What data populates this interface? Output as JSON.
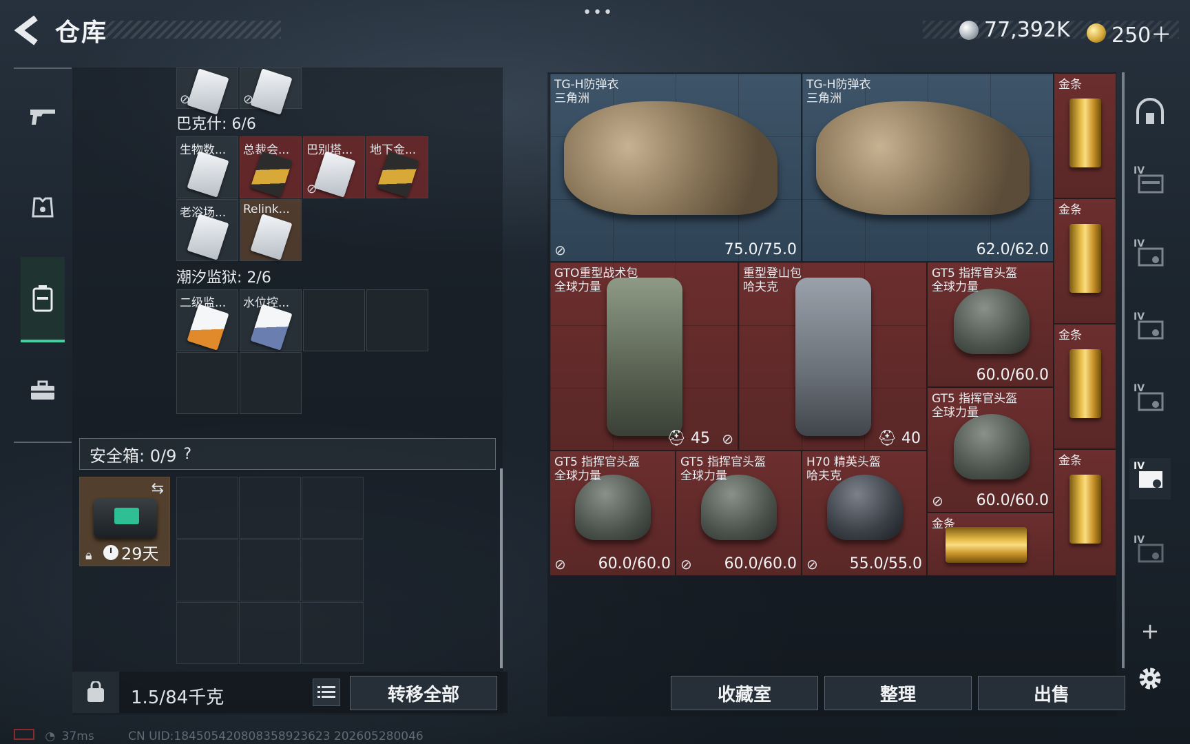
{
  "header": {
    "title": "仓库",
    "menu": "•••",
    "currency_silver": "77,392K",
    "currency_gold": "250＋"
  },
  "left_panel": {
    "partial_top_count": 2,
    "section1": {
      "label": "巴克什: 6/6",
      "items": [
        "生物数...",
        "总裁会...",
        "巴别塔...",
        "地下金...",
        "老浴场...",
        "Relink..."
      ]
    },
    "section2": {
      "label": "潮汐监狱: 2/6",
      "items": [
        "二级监...",
        "水位控..."
      ]
    },
    "safebox": {
      "label": "安全箱: 0/9",
      "help": "?",
      "item_timer": "29天"
    },
    "weight": "1.5/84千克",
    "transfer_all": "转移全部"
  },
  "stash": {
    "slots": [
      {
        "id": "vest1",
        "name": "TG-H防弹衣\n三角洲",
        "value": "75.0/75.0"
      },
      {
        "id": "vest2",
        "name": "TG-H防弹衣\n三角洲",
        "value": "62.0/62.0"
      },
      {
        "id": "gold1",
        "name": "金条"
      },
      {
        "id": "gold2",
        "name": "金条"
      },
      {
        "id": "bag1",
        "name": "GTO重型战术包\n全球力量",
        "cap": "45"
      },
      {
        "id": "bag2",
        "name": "重型登山包\n哈夫克",
        "cap": "40"
      },
      {
        "id": "helm1",
        "name": "GT5 指挥官头盔\n全球力量",
        "value": "60.0/60.0"
      },
      {
        "id": "gold3",
        "name": "金条"
      },
      {
        "id": "helm2",
        "name": "GT5 指挥官头盔\n全球力量",
        "value": "60.0/60.0"
      },
      {
        "id": "gold4",
        "name": "金条"
      },
      {
        "id": "helm3",
        "name": "GT5 指挥官头盔\n全球力量",
        "value": "60.0/60.0"
      },
      {
        "id": "helm4",
        "name": "GT5 指挥官头盔\n全球力量",
        "value": "60.0/60.0"
      },
      {
        "id": "helm5",
        "name": "H70 精英头盔\n哈夫克",
        "value": "55.0/55.0"
      },
      {
        "id": "gold5",
        "name": "金条"
      }
    ]
  },
  "buttons": {
    "collection": "收藏室",
    "sort": "整理",
    "sell": "出售"
  },
  "right_bar": {
    "level": "IV",
    "add": "+"
  },
  "status": {
    "ping": "37ms",
    "uid": "CN UID:184505420808358923623 202605280046"
  }
}
